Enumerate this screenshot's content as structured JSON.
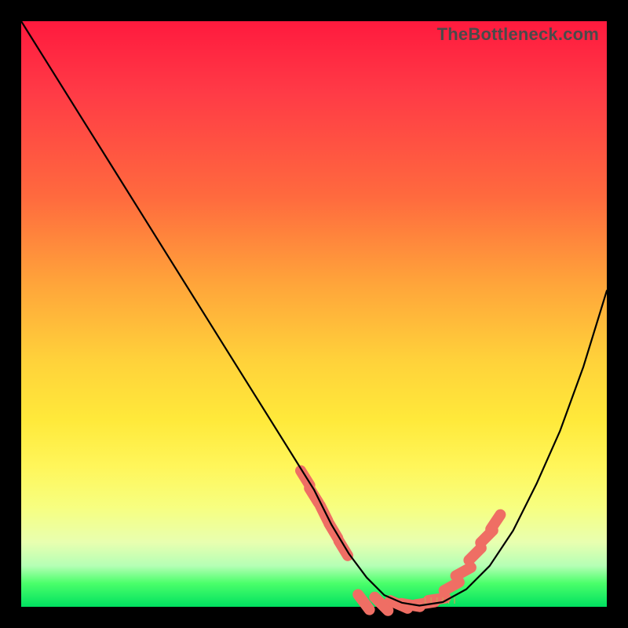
{
  "watermark": "TheBottleneck.com",
  "colors": {
    "tick": "#ef6e64",
    "curve": "#000000"
  },
  "chart_data": {
    "type": "line",
    "title": "",
    "xlabel": "",
    "ylabel": "",
    "xlim": [
      0,
      100
    ],
    "ylim": [
      0,
      100
    ],
    "grid": false,
    "legend": false,
    "series": [
      {
        "name": "bottleneck-curve",
        "x": [
          0,
          5,
          10,
          15,
          20,
          25,
          30,
          35,
          40,
          45,
          50,
          53,
          56,
          59,
          62,
          65,
          68,
          72,
          76,
          80,
          84,
          88,
          92,
          96,
          100
        ],
        "y": [
          100,
          92,
          84,
          76,
          68,
          60,
          52,
          44,
          36,
          28,
          20,
          14,
          9,
          5,
          2,
          0.7,
          0.2,
          0.8,
          3,
          7,
          13,
          21,
          30,
          41,
          54
        ],
        "note": "percent bottleneck vs normalized x; valley minimum near x≈67"
      }
    ],
    "highlight_ticks_left": {
      "note": "salmon dash cluster on descending arm, y-range ≈ 9–22%",
      "points": [
        {
          "x": 48.5,
          "y": 22
        },
        {
          "x": 50.0,
          "y": 19
        },
        {
          "x": 51.7,
          "y": 16
        },
        {
          "x": 53.3,
          "y": 13
        },
        {
          "x": 55.0,
          "y": 10
        }
      ]
    },
    "highlight_ticks_right": {
      "note": "salmon dash cluster on ascending arm, y-range ≈ 1–15%",
      "points": [
        {
          "x": 71.0,
          "y": 1.3
        },
        {
          "x": 73.5,
          "y": 3.5
        },
        {
          "x": 75.5,
          "y": 6.0
        },
        {
          "x": 77.5,
          "y": 9.0
        },
        {
          "x": 79.5,
          "y": 12.0
        },
        {
          "x": 81.0,
          "y": 14.5
        }
      ]
    },
    "highlight_ticks_bottom": {
      "note": "salmon dashes lying along valley floor",
      "points": [
        {
          "x": 58.5,
          "y": 0.8
        },
        {
          "x": 61.5,
          "y": 0.5
        },
        {
          "x": 64.5,
          "y": 0.4
        },
        {
          "x": 66.5,
          "y": 0.3
        },
        {
          "x": 69.0,
          "y": 0.6
        }
      ]
    },
    "tiny_baseline_marks": {
      "note": "small pale-olive vertical tick marks just above bottom edge between the two salmon clusters",
      "x_positions": [
        69,
        70,
        71,
        72,
        73,
        74
      ]
    }
  }
}
